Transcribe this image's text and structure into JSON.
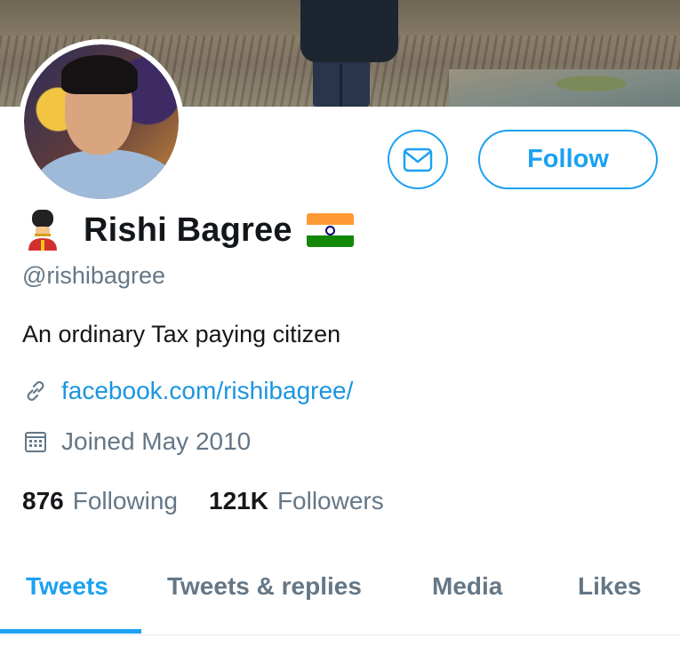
{
  "profile": {
    "name": "Rishi Bagree",
    "handle": "@rishibagree",
    "bio": "An ordinary Tax paying citizen",
    "link": "facebook.com/rishibagree/",
    "joined": "Joined May 2010"
  },
  "actions": {
    "follow_label": "Follow",
    "message_icon": "envelope-icon"
  },
  "stats": {
    "following_count": "876",
    "following_label": "Following",
    "followers_count": "121K",
    "followers_label": "Followers"
  },
  "tabs": [
    {
      "label": "Tweets",
      "active": true
    },
    {
      "label": "Tweets & replies",
      "active": false
    },
    {
      "label": "Media",
      "active": false
    },
    {
      "label": "Likes",
      "active": false
    }
  ],
  "emojis": {
    "name_prefix": "guardsman-emoji",
    "name_suffix": "india-flag-emoji"
  },
  "colors": {
    "accent": "#1da1f2",
    "link": "#1b95e0",
    "secondary_text": "#657786",
    "primary_text": "#14171a"
  }
}
